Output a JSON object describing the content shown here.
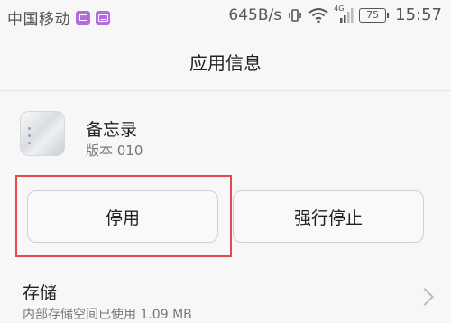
{
  "status_bar": {
    "carrier": "中国移动",
    "net_speed": "645B/s",
    "network_type": "4G",
    "battery": "75",
    "time": "15:57",
    "icons": [
      "notification-icon",
      "keyboard-icon",
      "vibrate-icon",
      "wifi-icon",
      "signal-icon",
      "battery-icon"
    ]
  },
  "header": {
    "title": "应用信息"
  },
  "app": {
    "name": "备忘录",
    "version": "版本 010",
    "icon": "memo-app-icon"
  },
  "actions": {
    "disable_label": "停用",
    "force_stop_label": "强行停止"
  },
  "storage": {
    "title": "存储",
    "subtitle": "内部存储空间已使用 1.09 MB"
  },
  "colors": {
    "highlight": "#e8474d",
    "notification_badge": "#b56be0"
  }
}
